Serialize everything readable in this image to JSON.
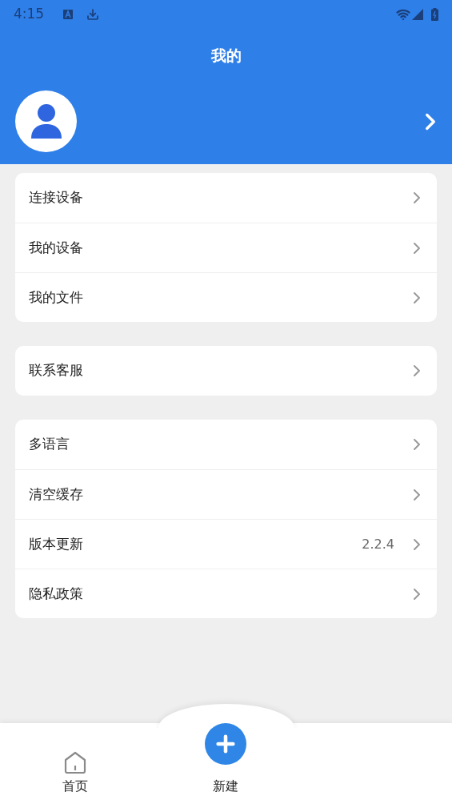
{
  "status_bar": {
    "time": "4:15"
  },
  "header": {
    "title": "我的"
  },
  "groups": [
    {
      "items": [
        {
          "label": "连接设备"
        },
        {
          "label": "我的设备"
        },
        {
          "label": "我的文件"
        }
      ]
    },
    {
      "items": [
        {
          "label": "联系客服"
        }
      ]
    },
    {
      "items": [
        {
          "label": "多语言"
        },
        {
          "label": "清空缓存"
        },
        {
          "label": "版本更新",
          "value": "2.2.4"
        },
        {
          "label": "隐私政策"
        }
      ]
    }
  ],
  "nav": [
    {
      "kind": "home",
      "label": "首页"
    },
    {
      "kind": "add",
      "label": "新建"
    }
  ]
}
